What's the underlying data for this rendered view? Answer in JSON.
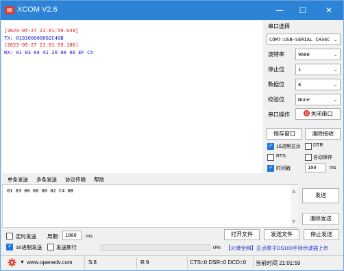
{
  "window": {
    "title": "XCOM V2.6",
    "min": "—",
    "max": "☐",
    "close": "✕"
  },
  "recv": {
    "lines": [
      {
        "text": "[2023-05-27 21:01:59.033]",
        "color": "red"
      },
      {
        "text": "TX: 010300000002C40B",
        "color": "blue"
      },
      {
        "text": "[2023-05-27 21:01:59.186]",
        "color": "red"
      },
      {
        "text": "RX: 01 03 04 41 20 00 00 EF C5",
        "color": "blue"
      }
    ]
  },
  "panel": {
    "port_label": "串口选择",
    "port_value": "COM7:USB-SERIAL CH34C",
    "baud_label": "波特率",
    "baud_value": "9600",
    "stopbit_label": "停止位",
    "stopbit_value": "1",
    "databit_label": "数据位",
    "databit_value": "8",
    "parity_label": "校验位",
    "parity_value": "None",
    "op_label": "串口操作",
    "close_port": "关闭串口",
    "save_window": "保存窗口",
    "clear_recv": "清除接收",
    "hex_display": "16进制显示",
    "dtr": "DTR",
    "rts": "RTS",
    "auto_save": "自动保存",
    "timestamp": "时间戳",
    "timestamp_value": "100",
    "timestamp_unit": "ms"
  },
  "tabs": [
    "单条发送",
    "多条发送",
    "协议传输",
    "帮助"
  ],
  "send": {
    "text": "01 03 00 00 00 02 C4 0B",
    "send_button": "发送",
    "clear_send": "清除发送"
  },
  "controls": {
    "timed_send": "定时发送",
    "period_label": "周期:",
    "period_value": "1000",
    "period_unit": "ms",
    "open_file": "打开文件",
    "send_file": "发送文件",
    "stop_send": "停止发送",
    "hex_send": "16进制发送",
    "send_newline": "发送新行",
    "progress_text": "0%",
    "progress_value": 0,
    "ad_text": "【火爆全网】正点原子DS100手持示波器上市"
  },
  "status": {
    "website": "www.openedv.com",
    "s": "S:8",
    "r": "R:9",
    "lines": "CTS=0 DSR=0 DCD=0",
    "time": "当前时间 21:01:59"
  }
}
